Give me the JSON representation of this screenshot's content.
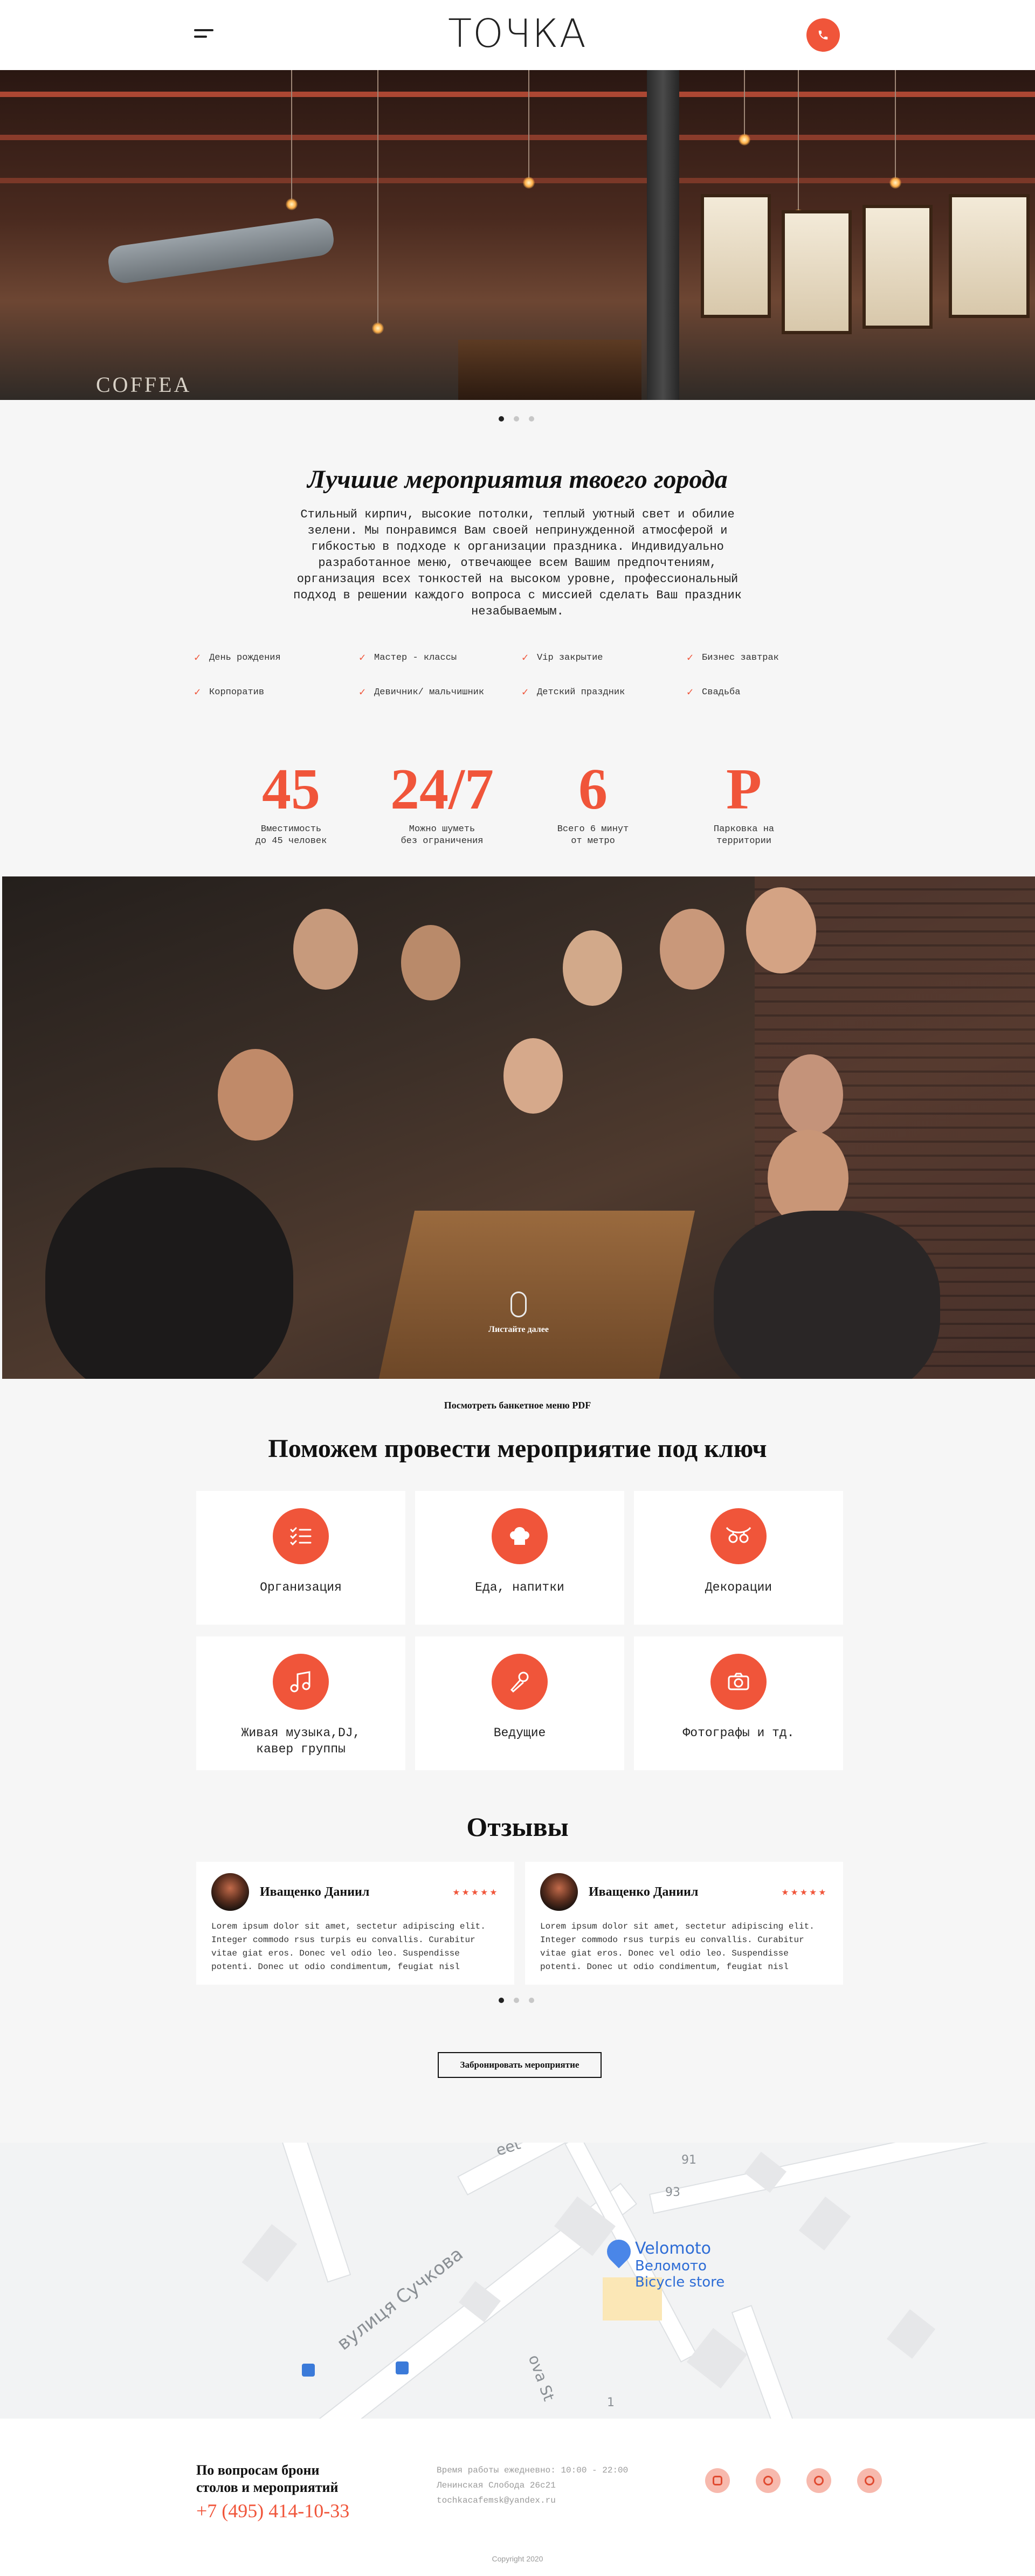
{
  "header": {
    "logo": "ТОЧКА"
  },
  "hero": {
    "sign_text": "COFFEA",
    "slides_count": 3,
    "active_slide": 1
  },
  "about": {
    "title": "Лучшие мероприятия твоего города",
    "text": "Стильный кирпич, высокие потолки, теплый уютный свет и обилие зелени. Мы понравимся Вам своей непринужденной атмосферой и гибкостью в подходе к организации праздника. Индивидуально разработанное меню, отвечающее всем Вашим предпочтениям, организация всех тонкостей на высоком уровне, профессиональный подход в решении каждого вопроса с миссией сделать Ваш праздник незабываемым.",
    "features": [
      "День рождения",
      "Мастер - классы",
      "Vip закрытие",
      "Бизнес завтрак",
      "Корпоратив",
      "Девичник/ мальчишник",
      "Детский праздник",
      "Свадьба"
    ]
  },
  "stats": [
    {
      "num": "45",
      "label": "Вместимость\nдо 45 человек"
    },
    {
      "num": "24/7",
      "label": "Можно шуметь\nбез ограничения"
    },
    {
      "num": "6",
      "label": "Всего 6 минут\nот метро"
    },
    {
      "num": "P",
      "label": "Парковка на\nтерритории"
    }
  ],
  "party": {
    "scroll_hint": "Листайте далее"
  },
  "menu_link": "Посмотреть банкетное меню PDF",
  "services": {
    "title": "Поможем провести мероприятие под ключ",
    "items": [
      {
        "label": "Организация",
        "icon": "checklist-icon"
      },
      {
        "label": "Еда, напитки",
        "icon": "chef-hat-icon"
      },
      {
        "label": "Декорации",
        "icon": "garland-icon"
      },
      {
        "label": "Живая музыка,DJ,\nкавер группы",
        "icon": "music-note-icon"
      },
      {
        "label": "Ведущие",
        "icon": "microphone-icon"
      },
      {
        "label": "Фотографы и тд.",
        "icon": "camera-icon"
      }
    ]
  },
  "reviews": {
    "title": "Отзывы",
    "items": [
      {
        "name": "Иващенко Даниил",
        "stars": "★★★★★",
        "text": "Lorem ipsum dolor sit amet, sectetur adipiscing elit. Integer commodo rsus turpis eu convallis. Curabitur vitae giat eros. Donec vel odio leo. Suspendisse potenti. Donec ut odio condimentum, feugiat nisl"
      },
      {
        "name": "Иващенко Даниил",
        "stars": "★★★★★",
        "text": "Lorem ipsum dolor sit amet, sectetur adipiscing elit. Integer commodo rsus turpis eu convallis. Curabitur vitae giat eros. Donec vel odio leo. Suspendisse potenti. Donec ut odio condimentum, feugiat nisl"
      }
    ],
    "slides_count": 3,
    "active_slide": 1
  },
  "book_button": "Забронировать мероприятие",
  "map": {
    "street_1": "вулиця Сучкова",
    "street_2": "ova St",
    "street_3": "eet",
    "house_91": "91",
    "house_93": "93",
    "house_1": "1",
    "place_name": "Velomoto",
    "place_name_local": "Веломото",
    "place_type": "Bicycle store"
  },
  "footer": {
    "question": "По вопросам брони\nстолов и мероприятий",
    "phone": "+7 (495) 414-10-33",
    "hours": "Время работы ежедневно: 10:00 - 22:00",
    "address": "Ленинская Слобода 26с21",
    "email": "tochkacafemsk@yandex.ru",
    "socials": [
      "instagram-icon",
      "telegram-icon",
      "whatsapp-icon",
      "viber-icon"
    ],
    "copyright": "Copyright 2020"
  },
  "colors": {
    "accent": "#f0553a",
    "background": "#f6f6f6",
    "card": "#ffffff"
  }
}
